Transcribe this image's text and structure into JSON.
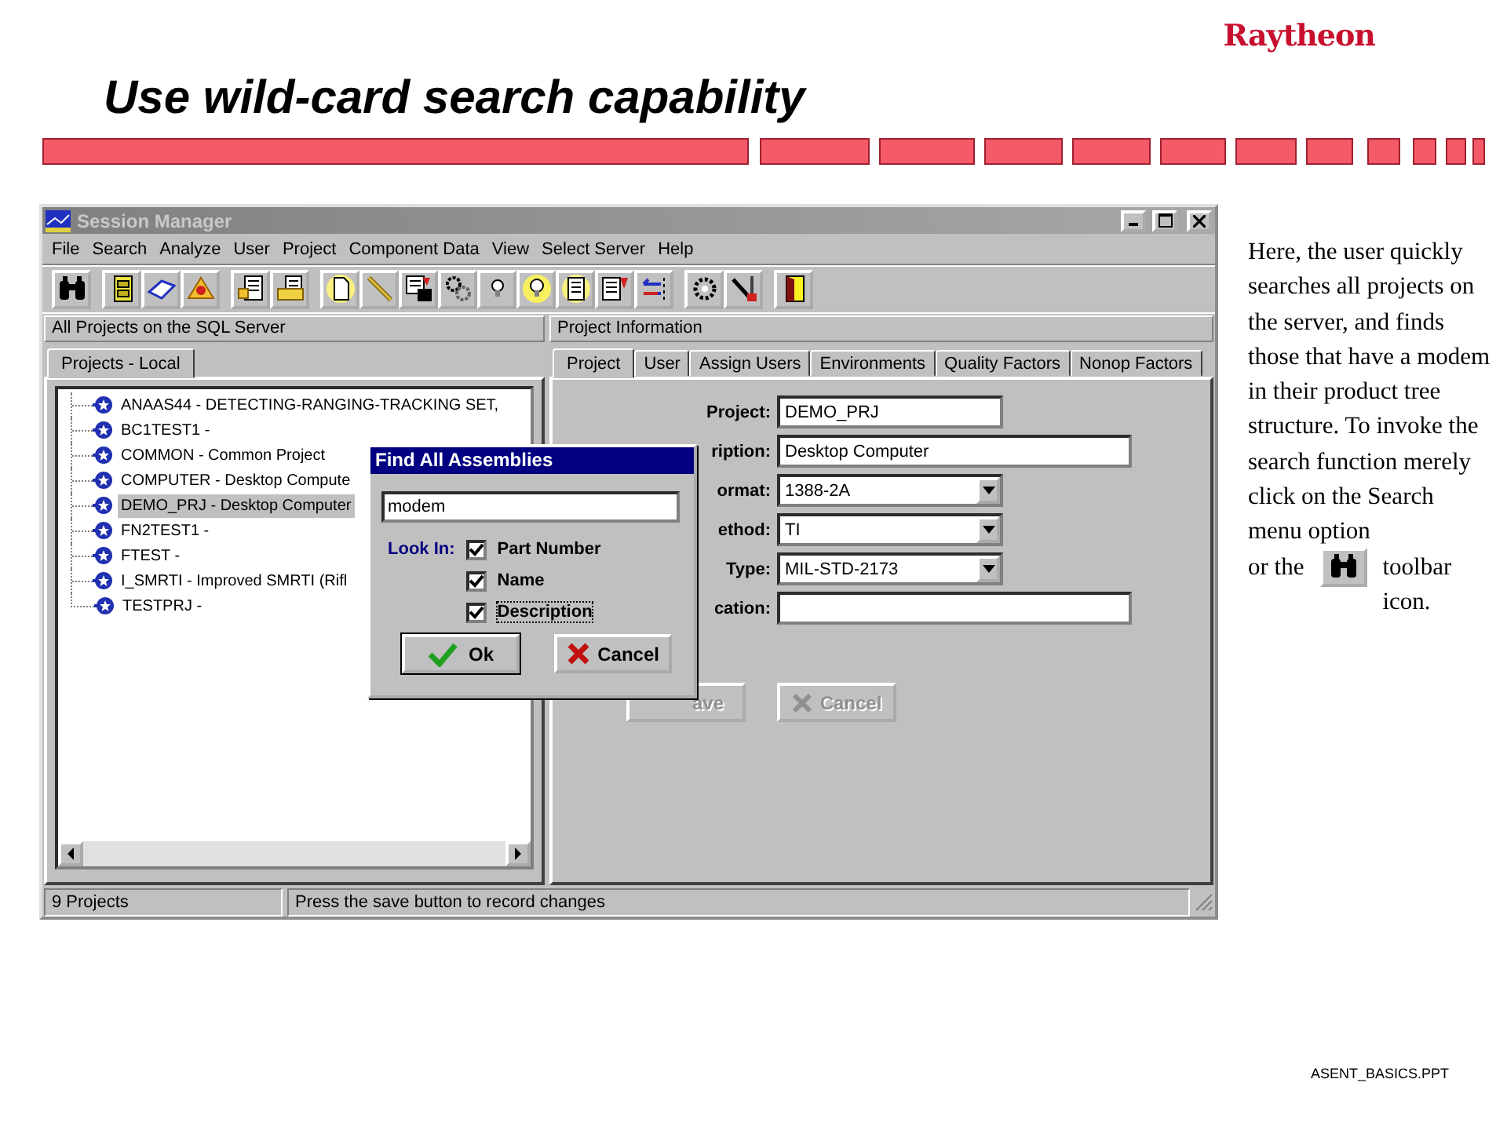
{
  "slide": {
    "logo": "Raytheon",
    "title": "Use wild-card search capability",
    "footer": "ASENT_BASICS.PPT",
    "notes": {
      "text_1": "Here, the user quickly searches all projects on the server, and finds those that have a modem in their product tree structure. To invoke the search function merely click on the Search menu option",
      "text_2": "or the",
      "text_3": "toolbar icon."
    }
  },
  "window": {
    "title": "Session Manager",
    "active": false
  },
  "menu": [
    "File",
    "Search",
    "Analyze",
    "User",
    "Project",
    "Component Data",
    "View",
    "Select Server",
    "Help"
  ],
  "left_pane": {
    "header": "All Projects on the SQL Server",
    "tabs": [
      {
        "label": "Projects - Local",
        "selected": true
      }
    ],
    "tree": [
      {
        "label": "ANAAS44 - DETECTING-RANGING-TRACKING SET,",
        "selected": false
      },
      {
        "label": "BC1TEST1 -",
        "selected": false
      },
      {
        "label": "COMMON - Common Project",
        "selected": false
      },
      {
        "label": "COMPUTER - Desktop Compute",
        "selected": false
      },
      {
        "label": "DEMO_PRJ - Desktop Computer",
        "selected": true
      },
      {
        "label": "FN2TEST1 -",
        "selected": false
      },
      {
        "label": "FTEST -",
        "selected": false
      },
      {
        "label": "I_SMRTI - Improved SMRTI (Rifl",
        "selected": false
      },
      {
        "label": "TESTPRJ -",
        "selected": false
      }
    ]
  },
  "right_pane": {
    "header": "Project Information",
    "tabs": [
      {
        "label": "Project",
        "selected": true
      },
      {
        "label": "User",
        "selected": false
      },
      {
        "label": "Assign Users",
        "selected": false
      },
      {
        "label": "Environments",
        "selected": false
      },
      {
        "label": "Quality Factors",
        "selected": false
      },
      {
        "label": "Nonop Factors",
        "selected": false
      }
    ],
    "form": [
      {
        "label": "Project:",
        "value": "DEMO_PRJ",
        "kind": "short"
      },
      {
        "label": "ription:",
        "value": "Desktop Computer",
        "kind": "long"
      },
      {
        "label": "ormat:",
        "value": "1388-2A",
        "kind": "dropdown"
      },
      {
        "label": "ethod:",
        "value": "TI",
        "kind": "dropdown"
      },
      {
        "label": "Type:",
        "value": "MIL-STD-2173",
        "kind": "dropdown"
      },
      {
        "label": "cation:",
        "kind": "long"
      }
    ],
    "buttons": [
      {
        "label": "ave",
        "kind": "save",
        "disabled": true
      },
      {
        "label": "Cancel",
        "kind": "cancel",
        "disabled": true
      }
    ]
  },
  "status_bar": [
    "9 Projects",
    "Press the save button to record changes"
  ],
  "dialog": {
    "title": "Find All Assemblies",
    "search_value": "modem",
    "look_in_label": "Look In:",
    "options": [
      {
        "label": "Part Number",
        "checked": true,
        "focused": false
      },
      {
        "label": "Name",
        "checked": true,
        "focused": false
      },
      {
        "label": "Description",
        "checked": true,
        "focused": true
      }
    ],
    "buttons": [
      {
        "label": "Ok",
        "kind": "ok"
      },
      {
        "label": "Cancel",
        "kind": "cancel"
      }
    ]
  }
}
